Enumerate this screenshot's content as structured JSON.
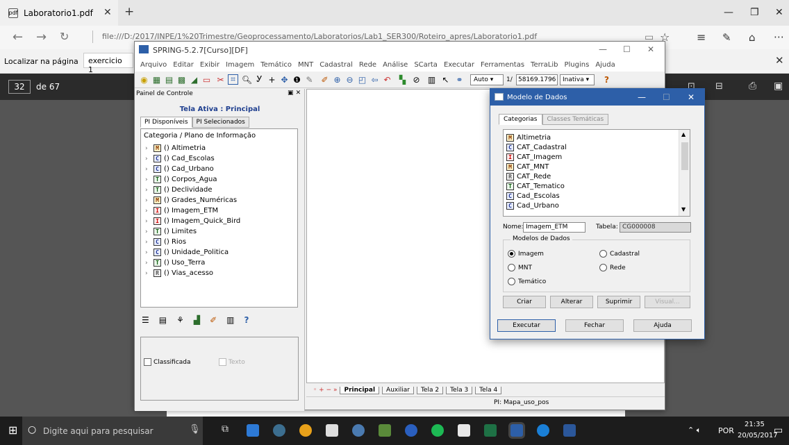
{
  "browser": {
    "tab_title": "Laboratorio1.pdf",
    "url": "file:///D:/2017/INPE/1%20Trimestre/Geoprocessamento/Laboratorios/Lab1_SER300/Roteiro_apres/Laboratorio1.pdf",
    "find_label": "Localizar na página",
    "find_value": "exercicio 1",
    "page_current": "32",
    "page_total": "de 67"
  },
  "spring": {
    "title": "SPRING-5.2.7[Curso][DF]",
    "menu": [
      "Arquivo",
      "Editar",
      "Exibir",
      "Imagem",
      "Temático",
      "MNT",
      "Cadastral",
      "Rede",
      "Análise",
      "SCarta",
      "Executar",
      "Ferramentas",
      "TerraLib",
      "Plugins",
      "Ajuda"
    ],
    "toolbar": {
      "scale_mode": "Auto",
      "scale_prefix": "1/",
      "scale_value": "58169.1796",
      "state": "Inativa"
    },
    "panel": {
      "title": "Painel de Controle",
      "active_screen": "Tela Ativa : Principal",
      "tabs": [
        "PI Disponíveis",
        "PI Selecionados"
      ],
      "list_header": "Categoria / Plano de Informação",
      "items": [
        {
          "type": "M",
          "label": "() Altimetria"
        },
        {
          "type": "C",
          "label": "() Cad_Escolas"
        },
        {
          "type": "C",
          "label": "() Cad_Urbano"
        },
        {
          "type": "T",
          "label": "() Corpos_Agua"
        },
        {
          "type": "T",
          "label": "() Declividade"
        },
        {
          "type": "M",
          "label": "() Grades_Numéricas"
        },
        {
          "type": "I",
          "label": "() Imagem_ETM"
        },
        {
          "type": "I",
          "label": "() Imagem_Quick_Bird"
        },
        {
          "type": "T",
          "label": "() Limites"
        },
        {
          "type": "C",
          "label": "() Rios"
        },
        {
          "type": "C",
          "label": "() Unidade_Politica"
        },
        {
          "type": "T",
          "label": "() Uso_Terra"
        },
        {
          "type": "R",
          "label": "() Vias_acesso"
        }
      ],
      "classificada_label": "Classificada",
      "texto_label": "Texto"
    },
    "screens": [
      "Principal",
      "Auxiliar",
      "Tela 2",
      "Tela 3",
      "Tela 4"
    ],
    "status_pi": "PI: Mapa_uso_pos"
  },
  "dialog": {
    "title": "Modelo de Dados",
    "tabs": [
      "Categorias",
      "Classes Temáticas"
    ],
    "categories": [
      {
        "type": "M",
        "label": "Altimetria"
      },
      {
        "type": "C",
        "label": "CAT_Cadastral"
      },
      {
        "type": "I",
        "label": "CAT_Imagem"
      },
      {
        "type": "M",
        "label": "CAT_MNT"
      },
      {
        "type": "R",
        "label": "CAT_Rede"
      },
      {
        "type": "T",
        "label": "CAT_Tematico"
      },
      {
        "type": "C",
        "label": "Cad_Escolas"
      },
      {
        "type": "C",
        "label": "Cad_Urbano"
      }
    ],
    "nome_label": "Nome:",
    "nome_value": "Imagem_ETM",
    "tabela_label": "Tabela:",
    "tabela_value": "CG000008",
    "group_label": "Modelos de Dados",
    "models": {
      "imagem": "Imagem",
      "cadastral": "Cadastral",
      "mnt": "MNT",
      "rede": "Rede",
      "tematico": "Temático"
    },
    "selected_model": "Imagem",
    "buttons": {
      "criar": "Criar",
      "alterar": "Alterar",
      "suprimir": "Suprimir",
      "visual": "Visual...",
      "executar": "Executar",
      "fechar": "Fechar",
      "ajuda": "Ajuda"
    }
  },
  "taskbar": {
    "search_placeholder": "Digite aqui para pesquisar",
    "lang": "POR",
    "time": "21:35",
    "date": "20/05/2017"
  }
}
